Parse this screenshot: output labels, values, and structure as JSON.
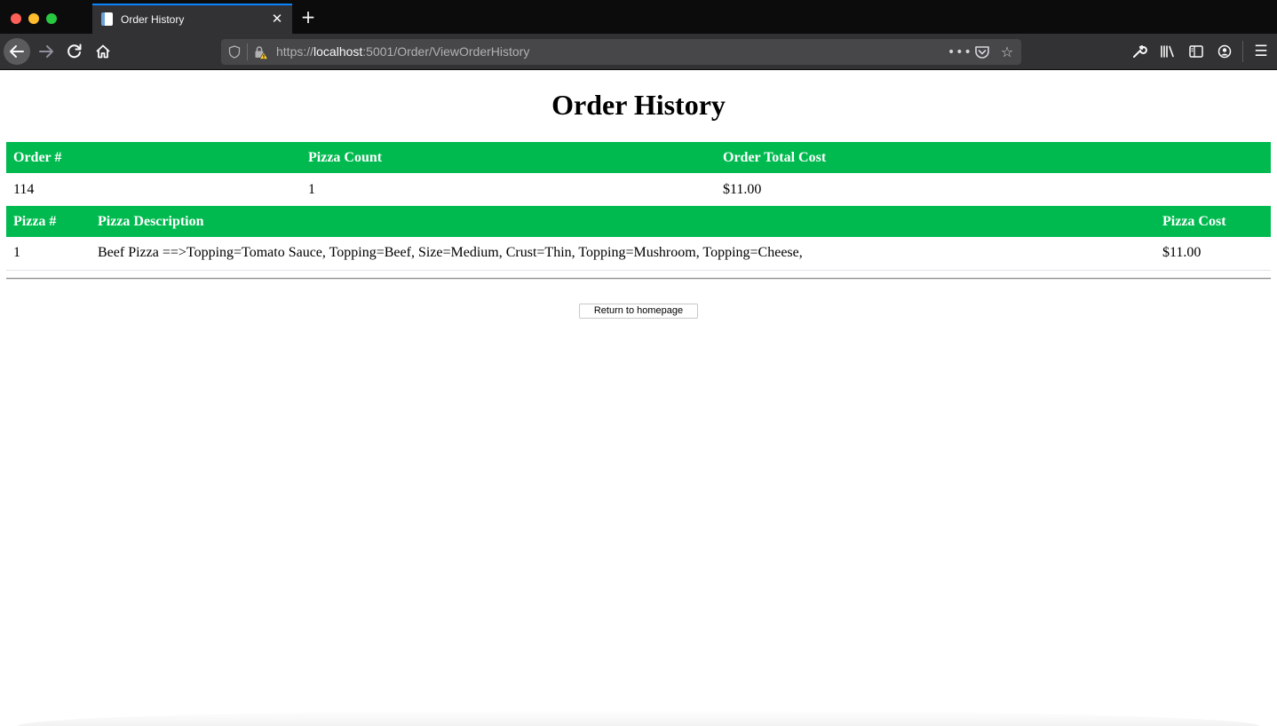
{
  "browser": {
    "tab_title": "Order History",
    "url_scheme": "https://",
    "url_host": "localhost",
    "url_rest": ":5001/Order/ViewOrderHistory",
    "accent_color": "#0a84ff"
  },
  "page": {
    "title": "Order History",
    "order_headers": {
      "order_num": "Order #",
      "pizza_count": "Pizza Count",
      "total_cost": "Order Total Cost"
    },
    "order": {
      "order_num": "114",
      "pizza_count": "1",
      "total_cost": "$11.00"
    },
    "pizza_headers": {
      "pizza_num": "Pizza #",
      "description": "Pizza Description",
      "cost": "Pizza Cost"
    },
    "pizzas": [
      {
        "pizza_num": "1",
        "description": "Beef Pizza ==>Topping=Tomato Sauce, Topping=Beef, Size=Medium, Crust=Thin, Topping=Mushroom, Topping=Cheese,",
        "cost": "$11.00"
      }
    ],
    "header_color": "#00ba4f",
    "return_button": "Return to homepage"
  }
}
